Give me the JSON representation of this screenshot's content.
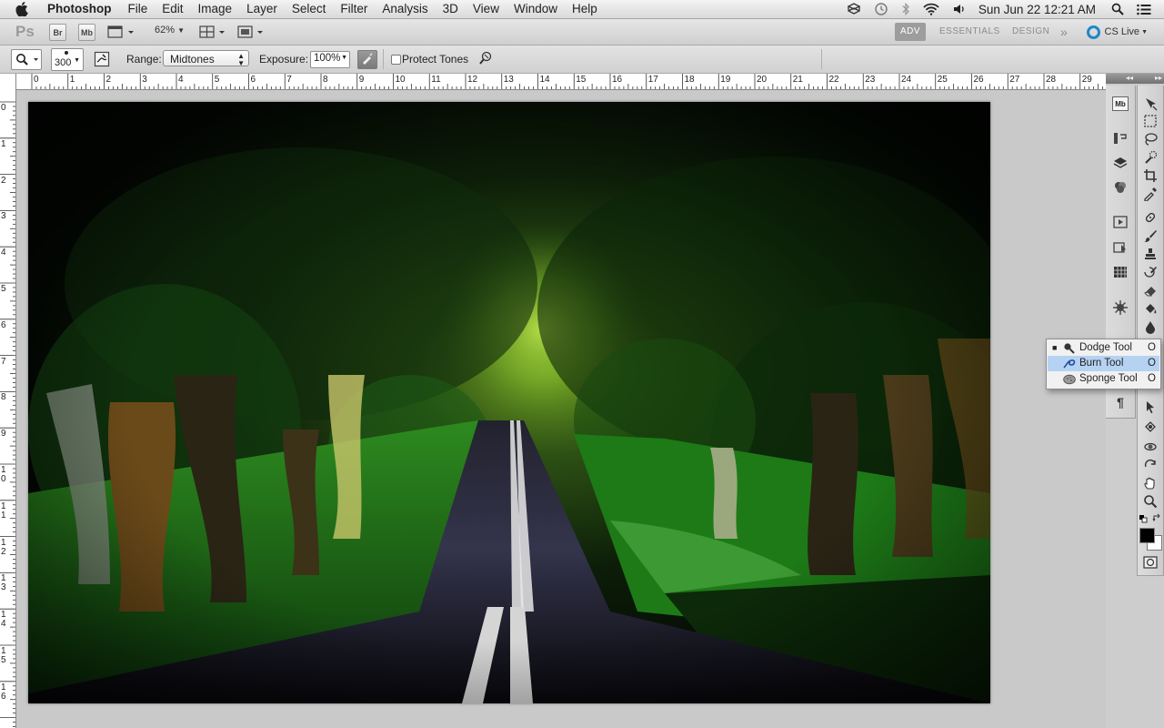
{
  "menubar": {
    "app_name": "Photoshop",
    "items": [
      "File",
      "Edit",
      "Image",
      "Layer",
      "Select",
      "Filter",
      "Analysis",
      "3D",
      "View",
      "Window",
      "Help"
    ],
    "clock": "Sun Jun 22  12:21 AM"
  },
  "appbar": {
    "logo": "Ps",
    "bridge_label": "Br",
    "minibridge_label": "Mb",
    "zoom": "62%",
    "workspaces": [
      "ADV",
      "ESSENTIALS",
      "DESIGN"
    ],
    "more": "»",
    "cs_live": "CS Live"
  },
  "options": {
    "brush_size": "300",
    "range_label": "Range:",
    "range_value": "Midtones",
    "exposure_label": "Exposure:",
    "exposure_value": "100%",
    "protect_label": "Protect Tones"
  },
  "ruler": {
    "h_labels": [
      "0",
      "1",
      "2",
      "3",
      "4",
      "5",
      "6",
      "7",
      "8",
      "9",
      "10",
      "11",
      "12",
      "13",
      "14",
      "15",
      "16",
      "17",
      "18",
      "19",
      "20",
      "21",
      "22",
      "23",
      "24",
      "25",
      "26",
      "27",
      "28",
      "29"
    ],
    "v_labels": [
      "0",
      "1",
      "2",
      "3",
      "4",
      "5",
      "6",
      "7",
      "8",
      "9",
      "10",
      "11",
      "12",
      "13",
      "14",
      "15",
      "16"
    ]
  },
  "flyout": {
    "items": [
      {
        "label": "Dodge Tool",
        "shortcut": "O",
        "icon": "dodge-icon"
      },
      {
        "label": "Burn Tool",
        "shortcut": "O",
        "icon": "burn-icon"
      },
      {
        "label": "Sponge Tool",
        "shortcut": "O",
        "icon": "sponge-icon"
      }
    ],
    "selected_index": 1
  },
  "panel_dock": {
    "minibridge_label": "Mb",
    "paragraph_glyph": "¶"
  },
  "colors": {
    "foreground": "#000000",
    "background": "#ffffff",
    "accent": "#1f86c8"
  }
}
